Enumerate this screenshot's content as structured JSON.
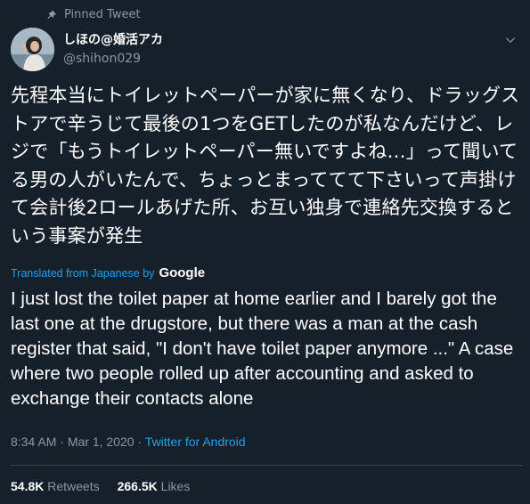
{
  "pinned_label": "Pinned Tweet",
  "user": {
    "display_name": "しほの@婚活アカ",
    "handle": "@shihon029"
  },
  "tweet": {
    "text": "先程本当にトイレットペーパーが家に無くなり、ドラッグストアで辛うじて最後の1つをGETしたのが私なんだけど、レジで「もうトイレットペーパー無いですよね…」って聞いてる男の人がいたんで、ちょっとまっててて下さいって声掛けて会計後2ロールあげた所、お互い独身で連絡先交換するという事案が発生"
  },
  "translation": {
    "label": "Translated from Japanese by",
    "provider": "Google",
    "text": "I just lost the toilet paper at home earlier and I barely got the last one at the drugstore, but there was a man at the cash register that said, \"I don't have toilet paper anymore ...\" A case where two people rolled up after accounting and asked to exchange their contacts alone"
  },
  "meta": {
    "time": "8:34 AM",
    "date": "Mar 1, 2020",
    "source": "Twitter for Android",
    "separator": " · "
  },
  "stats": {
    "retweets_count": "54.8K",
    "retweets_label": "Retweets",
    "likes_count": "266.5K",
    "likes_label": "Likes"
  },
  "colors": {
    "background": "#15202b",
    "secondary_text": "#8899a6",
    "accent": "#1da1f2"
  },
  "icons": {
    "pin": "pin-icon",
    "caret": "chevron-down-icon"
  }
}
